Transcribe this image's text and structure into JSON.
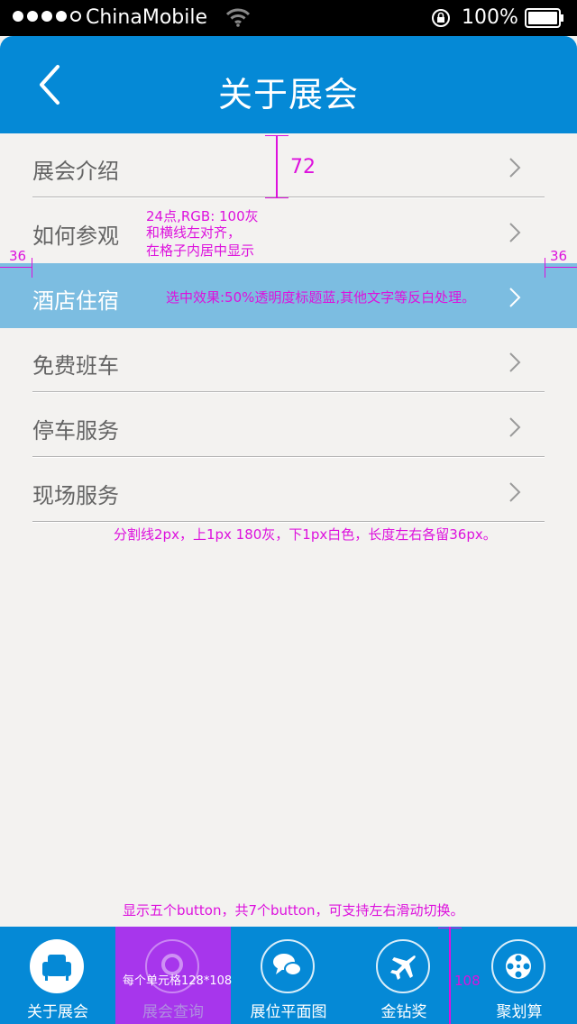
{
  "status_bar": {
    "carrier": "ChinaMobile",
    "battery": "100%",
    "signal_bars": 4,
    "signal_total": 5
  },
  "nav": {
    "title": "关于展会",
    "back_icon": "chevron-left-icon"
  },
  "menu": {
    "items": [
      {
        "label": "展会介绍",
        "selected": false
      },
      {
        "label": "如何参观",
        "selected": false
      },
      {
        "label": "酒店住宿",
        "selected": true
      },
      {
        "label": "免费班车",
        "selected": false
      },
      {
        "label": "停车服务",
        "selected": false
      },
      {
        "label": "现场服务",
        "selected": false
      }
    ],
    "chevron_icon": "chevron-right-icon"
  },
  "annotations": {
    "row_height": "72",
    "font_note_1": "24点,RGB: 100灰",
    "font_note_2": "和横线左对齐，",
    "font_note_3": "在格子内居中显示",
    "margin_left": "36",
    "margin_right": "36",
    "selected_note": "选中效果:50%透明度标题蓝,其他文字等反白处理。",
    "divider_note": "分割线2px，上1px 180灰，下1px白色，长度左右各留36px。",
    "tabbar_note": "显示五个button，共7个button，可支持左右滑动切换。",
    "cell_note": "每个单元格128*108",
    "tabbar_height": "108"
  },
  "tabs": [
    {
      "label": "关于展会",
      "icon": "sofa-icon",
      "active": true
    },
    {
      "label": "展会查询",
      "icon": "search-icon",
      "active": false
    },
    {
      "label": "展位平面图",
      "icon": "chat-bubbles-icon",
      "active": false
    },
    {
      "label": "金钻奖",
      "icon": "airplane-icon",
      "active": false
    },
    {
      "label": "聚划算",
      "icon": "film-reel-icon",
      "active": false
    }
  ],
  "colors": {
    "primary_blue": "#0589d6",
    "selected_row": "#7cbde1",
    "background": "#f3f2f0",
    "text_gray": "#646464",
    "annotation": "#dd11dd"
  }
}
